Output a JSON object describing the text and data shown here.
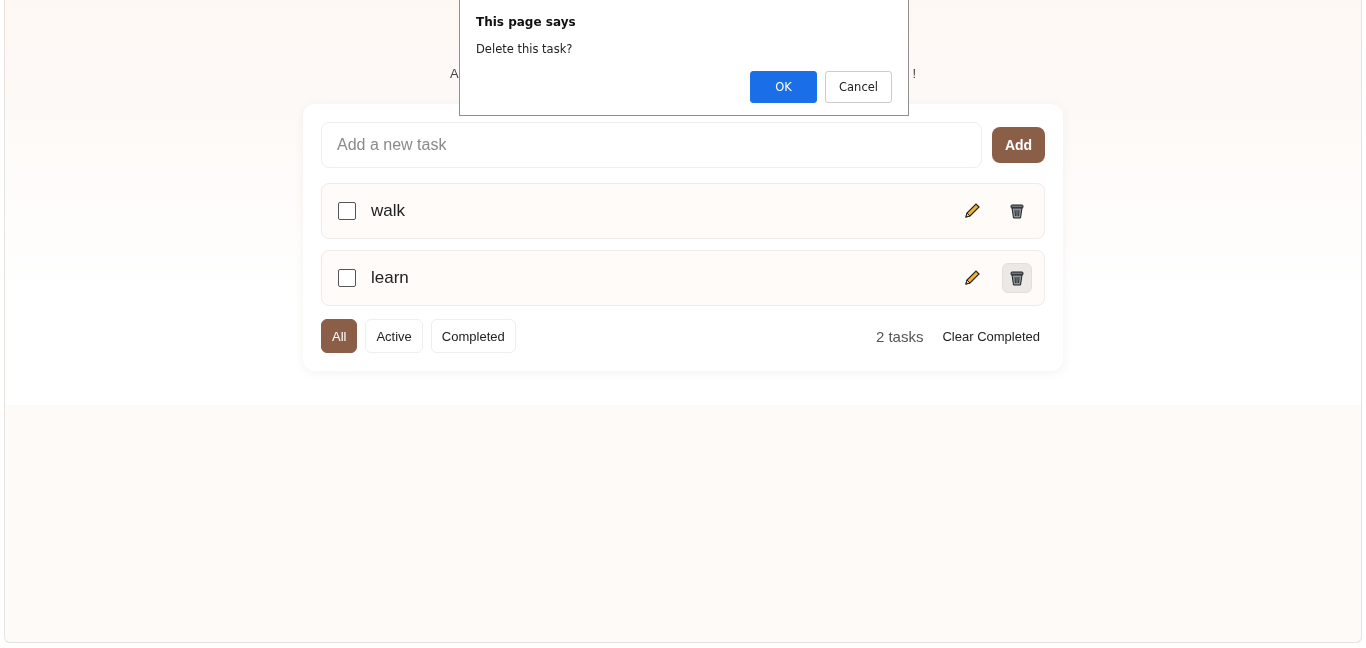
{
  "subtitle": {
    "left": "A",
    "right": "!"
  },
  "dialog": {
    "title": "This page says",
    "message": "Delete this task?",
    "buttons": [
      {
        "label": "OK",
        "kind": "primary"
      },
      {
        "label": "Cancel",
        "kind": "secondary"
      }
    ]
  },
  "new_task": {
    "placeholder": "Add a new task",
    "button": "Add"
  },
  "tasks": [
    {
      "text": "walk",
      "checked": false,
      "hovered_delete": false
    },
    {
      "text": "learn",
      "checked": false,
      "hovered_delete": true
    }
  ],
  "filters": [
    {
      "label": "All",
      "selected": true
    },
    {
      "label": "Active",
      "selected": false
    },
    {
      "label": "Completed",
      "selected": false
    }
  ],
  "count": "2 tasks",
  "clear_button": "Clear Completed"
}
